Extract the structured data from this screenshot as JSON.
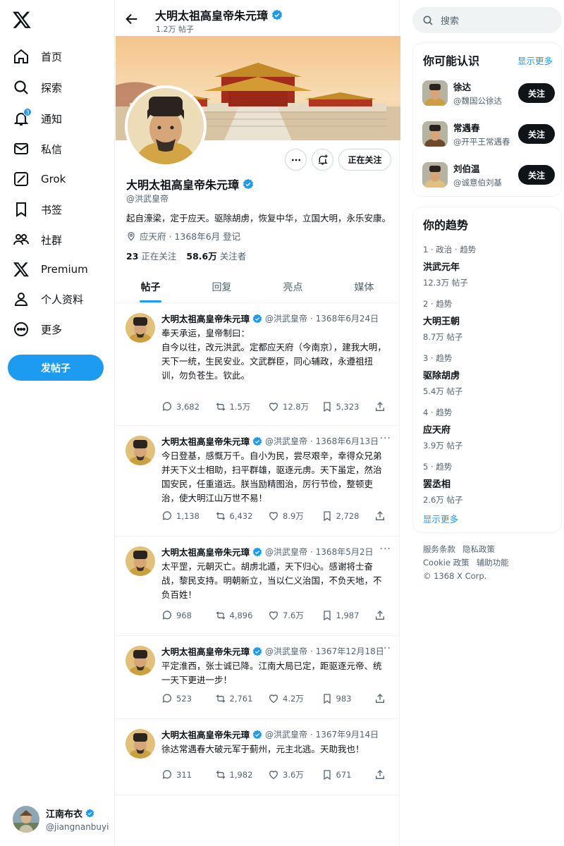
{
  "nav": {
    "items": [
      {
        "label": "首页",
        "icon": "home-icon"
      },
      {
        "label": "探索",
        "icon": "search-icon"
      },
      {
        "label": "通知",
        "icon": "bell-icon",
        "badge": "3"
      },
      {
        "label": "私信",
        "icon": "mail-icon"
      },
      {
        "label": "Grok",
        "icon": "grok-icon"
      },
      {
        "label": "书签",
        "icon": "bookmark-icon"
      },
      {
        "label": "社群",
        "icon": "community-icon"
      },
      {
        "label": "Premium",
        "icon": "x-logo-icon"
      },
      {
        "label": "个人资料",
        "icon": "person-icon"
      },
      {
        "label": "更多",
        "icon": "more-circle-icon"
      }
    ],
    "post_button": "发帖子"
  },
  "current_user": {
    "name": "江南布衣",
    "handle": "@jiangnanbuyi"
  },
  "header": {
    "name": "大明太祖高皇帝朱元璋",
    "post_count": "1.2万 帖子"
  },
  "profile": {
    "name": "大明太祖高皇帝朱元璋",
    "handle": "@洪武皇帝",
    "bio": "起自濠梁，定于应天。驱除胡虏，恢复中华，立国大明，永乐安康。",
    "location_joined": "应天府 · 1368年6月 登记",
    "following_count": "23",
    "following_label": "正在关注",
    "followers_count": "58.6万",
    "followers_label": "关注者",
    "follow_state": "正在关注"
  },
  "tabs": [
    "帖子",
    "回复",
    "亮点",
    "媒体"
  ],
  "tweets": [
    {
      "name": "大明太祖高皇帝朱元璋",
      "handle": "@洪武皇帝",
      "date": "· 1368年6月24日",
      "text": "奉天承运，皇帝制曰：\n自今以往，改元洪武。定都应天府（今南京），建我大明，天下一统，生民安业。文武群臣，同心辅政，永遵祖扭训，勿负苍生。钦此。",
      "replies": "3,682",
      "retweets": "1.5万",
      "likes": "12.8万",
      "bookmarks": "5,323"
    },
    {
      "name": "大明太祖高皇帝朱元璋",
      "handle": "@洪武皇帝",
      "date": "· 1368年6月13日",
      "text": "今日登基，感慨万千。自小为民，尝尽艰辛，幸得众兄弟并天下义士相助，扫平群雄，驱逐元虏。天下虽定，然治国安民，任重道远。朕当励精图治，厉行节俭，整顿吏治，使大明江山万世不易！",
      "replies": "1,138",
      "retweets": "6,432",
      "likes": "8.9万",
      "bookmarks": "2,728"
    },
    {
      "name": "大明太祖高皇帝朱元璋",
      "handle": "@洪武皇帝",
      "date": "· 1368年5月2日",
      "text": "太平罡，元朝灭亡。胡虏北遁，天下归心。感谢将士奋战，黎民支持。明朝新立，当以仁义治国，不负天地，不负百姓！",
      "replies": "968",
      "retweets": "4,896",
      "likes": "7.6万",
      "bookmarks": "1,987"
    },
    {
      "name": "大明太祖高皇帝朱元璋",
      "handle": "@洪武皇帝",
      "date": "· 1367年12月18日",
      "text": "平定淮西，张士诚已降。江南大局已定，距驱逐元帝、统一天下更进一步！",
      "replies": "523",
      "retweets": "2,761",
      "likes": "4.2万",
      "bookmarks": "983"
    },
    {
      "name": "大明太祖高皇帝朱元璋",
      "handle": "@洪武皇帝",
      "date": "· 1367年9月14日",
      "text": "徐达常遇春大破元军于蓟州，元主北逃。天助我也！",
      "replies": "311",
      "retweets": "1,982",
      "likes": "3.6万",
      "bookmarks": "671"
    }
  ],
  "search": {
    "placeholder": "搜索"
  },
  "who_to_follow": {
    "title": "你可能认识",
    "show_more": "显示更多",
    "people": [
      {
        "name": "徐达",
        "handle": "@魏国公徐达",
        "button": "关注"
      },
      {
        "name": "常遇春",
        "handle": "@开平王常遇春",
        "button": "关注"
      },
      {
        "name": "刘伯温",
        "handle": "@诚意伯刘基",
        "button": "关注"
      }
    ]
  },
  "trends": {
    "title": "你的趋势",
    "items": [
      {
        "category": "1 · 政治 · 趋势",
        "title": "洪武元年",
        "count": "12.3万 帖子"
      },
      {
        "category": "2 · 趋势",
        "title": "大明王朝",
        "count": "8.7万 帖子"
      },
      {
        "category": "3 · 趋势",
        "title": "驱除胡虏",
        "count": "5.4万 帖子"
      },
      {
        "category": "4 · 趋势",
        "title": "应天府",
        "count": "3.9万 帖子"
      },
      {
        "category": "5 · 趋势",
        "title": "罢丞相",
        "count": "2.6万 帖子"
      }
    ],
    "show_more": "显示更多"
  },
  "footer": {
    "links": [
      "服务条款",
      "隐私政策",
      "Cookie 政策",
      "辅助功能"
    ],
    "copyright": "© 1368 X Corp."
  },
  "colors": {
    "accent": "#1d9bf0",
    "text": "#0f1419",
    "muted": "#536471"
  }
}
